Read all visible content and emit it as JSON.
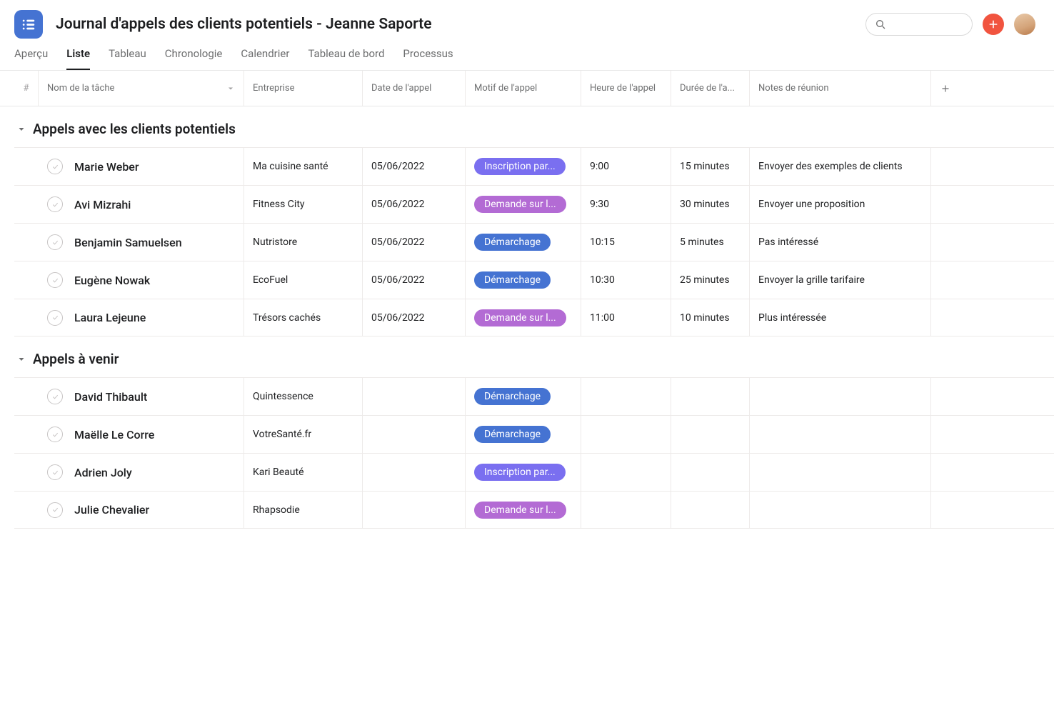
{
  "header": {
    "title": "Journal d'appels des clients potentiels - Jeanne Saporte"
  },
  "tabs": [
    {
      "label": "Aperçu",
      "active": false
    },
    {
      "label": "Liste",
      "active": true
    },
    {
      "label": "Tableau",
      "active": false
    },
    {
      "label": "Chronologie",
      "active": false
    },
    {
      "label": "Calendrier",
      "active": false
    },
    {
      "label": "Tableau de bord",
      "active": false
    },
    {
      "label": "Processus",
      "active": false
    }
  ],
  "columns": {
    "hash": "#",
    "name": "Nom de la tâche",
    "company": "Entreprise",
    "date": "Date de l'appel",
    "reason": "Motif de l'appel",
    "hour": "Heure de l'appel",
    "duration": "Durée de l'a...",
    "notes": "Notes de réunion"
  },
  "groups": [
    {
      "title": "Appels avec les clients potentiels",
      "rows": [
        {
          "name": "Marie Weber",
          "company": "Ma cuisine santé",
          "date": "05/06/2022",
          "reason": "Inscription par...",
          "reason_color": "indigo",
          "hour": "9:00",
          "duration": "15 minutes",
          "notes": "Envoyer des exemples de clients"
        },
        {
          "name": "Avi Mizrahi",
          "company": "Fitness City",
          "date": "05/06/2022",
          "reason": "Demande sur l...",
          "reason_color": "purple",
          "hour": "9:30",
          "duration": "30 minutes",
          "notes": "Envoyer une proposition"
        },
        {
          "name": "Benjamin Samuelsen",
          "company": "Nutristore",
          "date": "05/06/2022",
          "reason": "Démarchage",
          "reason_color": "blue",
          "hour": "10:15",
          "duration": "5 minutes",
          "notes": "Pas intéressé"
        },
        {
          "name": "Eugène Nowak",
          "company": "EcoFuel",
          "date": "05/06/2022",
          "reason": "Démarchage",
          "reason_color": "blue",
          "hour": "10:30",
          "duration": "25 minutes",
          "notes": "Envoyer la grille tarifaire"
        },
        {
          "name": "Laura Lejeune",
          "company": "Trésors cachés",
          "date": "05/06/2022",
          "reason": "Demande sur l...",
          "reason_color": "purple",
          "hour": "11:00",
          "duration": "10 minutes",
          "notes": "Plus intéressée"
        }
      ]
    },
    {
      "title": "Appels à venir",
      "rows": [
        {
          "name": "David Thibault",
          "company": "Quintessence",
          "date": "",
          "reason": "Démarchage",
          "reason_color": "blue",
          "hour": "",
          "duration": "",
          "notes": ""
        },
        {
          "name": "Maëlle Le Corre",
          "company": "VotreSanté.fr",
          "date": "",
          "reason": "Démarchage",
          "reason_color": "blue",
          "hour": "",
          "duration": "",
          "notes": ""
        },
        {
          "name": "Adrien Joly",
          "company": "Kari Beauté",
          "date": "",
          "reason": "Inscription par...",
          "reason_color": "indigo",
          "hour": "",
          "duration": "",
          "notes": ""
        },
        {
          "name": "Julie Chevalier",
          "company": "Rhapsodie",
          "date": "",
          "reason": "Demande sur l...",
          "reason_color": "purple",
          "hour": "",
          "duration": "",
          "notes": ""
        }
      ]
    }
  ]
}
